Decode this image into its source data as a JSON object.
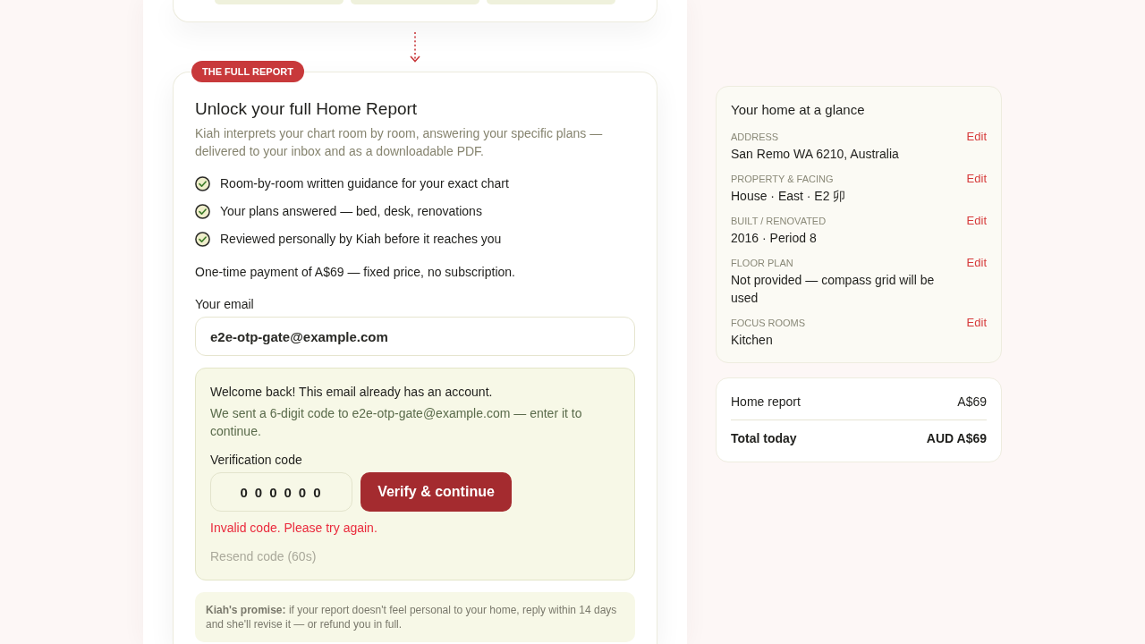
{
  "report": {
    "badge": "THE FULL REPORT",
    "title": "Unlock your full Home Report",
    "description": "Kiah interprets your chart room by room, answering your specific plans — delivered to your inbox and as a downloadable PDF.",
    "features": [
      "Room-by-room written guidance for your exact chart",
      "Your plans answered — bed, desk, renovations",
      "Reviewed personally by Kiah before it reaches you"
    ],
    "price_note": "One-time payment of A$69 — fixed price, no subscription.",
    "email": {
      "label": "Your email",
      "value": "e2e-otp-gate@example.com"
    },
    "verification": {
      "welcome": "Welcome back! This email already has an account.",
      "sent_message": "We sent a 6-digit code to e2e-otp-gate@example.com — enter it to continue.",
      "code_label": "Verification code",
      "code_value": "000000",
      "verify_button": "Verify & continue",
      "error": "Invalid code. Please try again.",
      "resend": {
        "label": "Resend code (60s)",
        "disabled": true
      }
    },
    "promise": "**Kiah's promise:** if your report doesn't feel personal to your home, reply within 14 days and she'll revise it — or refund you in full."
  },
  "glance": {
    "title": "Your home at a glance",
    "items": [
      {
        "label": "ADDRESS",
        "value": "San Remo WA 6210, Australia",
        "action": "Edit"
      },
      {
        "label": "PROPERTY & FACING",
        "value": "House · East · E2 卯",
        "action": "Edit"
      },
      {
        "label": "BUILT / RENOVATED",
        "value": "2016 · Period 8",
        "action": "Edit"
      },
      {
        "label": "FLOOR PLAN",
        "value": "Not provided — compass grid will be used",
        "action": "Edit"
      },
      {
        "label": "FOCUS ROOMS",
        "value": "Kitchen",
        "action": "Edit"
      }
    ]
  },
  "order_summary": {
    "rows": [
      {
        "kind": "line",
        "label": "Home report",
        "amount": "A$69"
      },
      {
        "kind": "total",
        "label": "Total today",
        "amount": "AUD A$69"
      }
    ]
  }
}
